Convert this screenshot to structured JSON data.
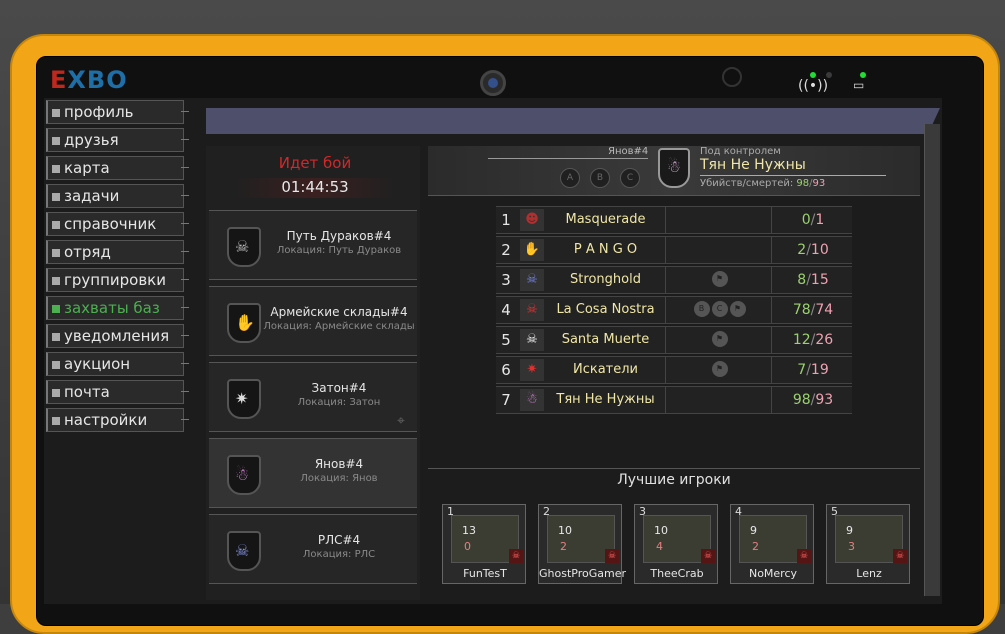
{
  "logo": "EXBO",
  "sidebar": {
    "items": [
      {
        "label": "профиль"
      },
      {
        "label": "друзья"
      },
      {
        "label": "карта"
      },
      {
        "label": "задачи"
      },
      {
        "label": "справочник"
      },
      {
        "label": "отряд"
      },
      {
        "label": "группировки"
      },
      {
        "label": "захваты баз"
      },
      {
        "label": "уведомления"
      },
      {
        "label": "аукцион"
      },
      {
        "label": "почта"
      },
      {
        "label": "настройки"
      }
    ],
    "active_index": 7
  },
  "battle": {
    "status": "Идет бой",
    "timer": "01:44:53"
  },
  "bases": [
    {
      "name": "Путь Дураков#4",
      "location": "Локация: Путь Дураков",
      "icon": "skull-emblem"
    },
    {
      "name": "Армейские склады#4",
      "location": "Локация: Армейские склады",
      "icon": "claw-emblem"
    },
    {
      "name": "Затон#4",
      "location": "Локация: Затон",
      "icon": "star-emblem"
    },
    {
      "name": "Янов#4",
      "location": "Локация: Янов",
      "icon": "octopus-emblem"
    },
    {
      "name": "РЛС#4",
      "location": "Локация: РЛС",
      "icon": "skull-emblem"
    }
  ],
  "header": {
    "base": "Янов#4",
    "abc": [
      "A",
      "B",
      "C"
    ],
    "control_label": "Под контролем",
    "owner": "Тян Не Нужны",
    "kd_label": "Убийств/смертей:",
    "kills": "98",
    "deaths": "93"
  },
  "clans": [
    {
      "rank": "1",
      "name": "Masquerade",
      "flags": [],
      "kills": "0",
      "deaths": "1",
      "icon": "mask-icon",
      "color": "#b03030"
    },
    {
      "rank": "2",
      "name": "P A N G O",
      "flags": [],
      "kills": "2",
      "deaths": "10",
      "icon": "claw-icon",
      "color": "#c070c0"
    },
    {
      "rank": "3",
      "name": "Stronghold",
      "flags": [
        "⚑"
      ],
      "kills": "8",
      "deaths": "15",
      "icon": "skull-icon",
      "color": "#7080e0"
    },
    {
      "rank": "4",
      "name": "La Cosa Nostra",
      "flags": [
        "B",
        "C",
        "⚑"
      ],
      "kills": "78",
      "deaths": "74",
      "icon": "skull-icon",
      "color": "#e03030"
    },
    {
      "rank": "5",
      "name": "Santa Muerte",
      "flags": [
        "⚑"
      ],
      "kills": "12",
      "deaths": "26",
      "icon": "skull-icon",
      "color": "#f0f0f0"
    },
    {
      "rank": "6",
      "name": "Искатели",
      "flags": [
        "⚑"
      ],
      "kills": "7",
      "deaths": "19",
      "icon": "star-icon",
      "color": "#e03030"
    },
    {
      "rank": "7",
      "name": "Тян Не Нужны",
      "flags": [],
      "kills": "98",
      "deaths": "93",
      "icon": "octopus-icon",
      "color": "#e090e0"
    }
  ],
  "best": {
    "title": "Лучшие игроки",
    "players": [
      {
        "num": "1",
        "kills": "13",
        "deaths": "0",
        "name": "FunTesT"
      },
      {
        "num": "2",
        "kills": "10",
        "deaths": "2",
        "name": "GhostProGamer"
      },
      {
        "num": "3",
        "kills": "10",
        "deaths": "4",
        "name": "TheeCrab"
      },
      {
        "num": "4",
        "kills": "9",
        "deaths": "2",
        "name": "NoMercy"
      },
      {
        "num": "5",
        "kills": "9",
        "deaths": "3",
        "name": "Lenz"
      }
    ]
  }
}
